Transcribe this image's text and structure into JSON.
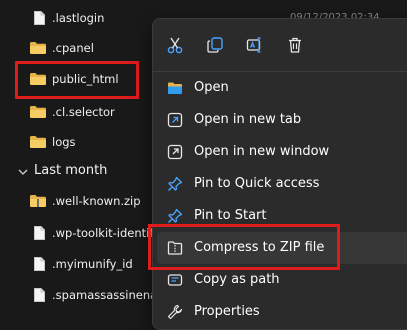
{
  "colors": {
    "background": "#191919",
    "menu_background": "#2b2b2b",
    "highlight_border": "#e01b1b",
    "folder": "#f2c55c"
  },
  "file_list": {
    "rows": [
      {
        "name": ".lastlogin",
        "type": "file",
        "date": "09/12/2023 02:34"
      },
      {
        "name": ".cpanel",
        "type": "folder"
      },
      {
        "name": "public_html",
        "type": "folder"
      },
      {
        "name": ".cl.selector",
        "type": "folder"
      },
      {
        "name": "logs",
        "type": "folder"
      }
    ],
    "group_header": "Last month",
    "group_rows": [
      {
        "name": ".well-known.zip",
        "type": "folder"
      },
      {
        "name": ".wp-toolkit-identif",
        "type": "file"
      },
      {
        "name": ".myimunify_id",
        "type": "file"
      },
      {
        "name": ".spamassassinenab",
        "type": "file"
      }
    ]
  },
  "context_menu": {
    "quick_actions": [
      {
        "icon": "cut-icon"
      },
      {
        "icon": "copy-icon"
      },
      {
        "icon": "rename-icon"
      },
      {
        "icon": "delete-icon"
      }
    ],
    "items": [
      {
        "label": "Open",
        "icon": "folder-open-icon"
      },
      {
        "label": "Open in new tab",
        "icon": "new-tab-icon"
      },
      {
        "label": "Open in new window",
        "icon": "new-window-icon"
      },
      {
        "label": "Pin to Quick access",
        "icon": "pin-icon"
      },
      {
        "label": "Pin to Start",
        "icon": "pin-icon"
      },
      {
        "label": "Compress to ZIP file",
        "icon": "zip-icon"
      },
      {
        "label": "Copy as path",
        "icon": "copy-path-icon"
      },
      {
        "label": "Properties",
        "icon": "wrench-icon"
      }
    ]
  }
}
